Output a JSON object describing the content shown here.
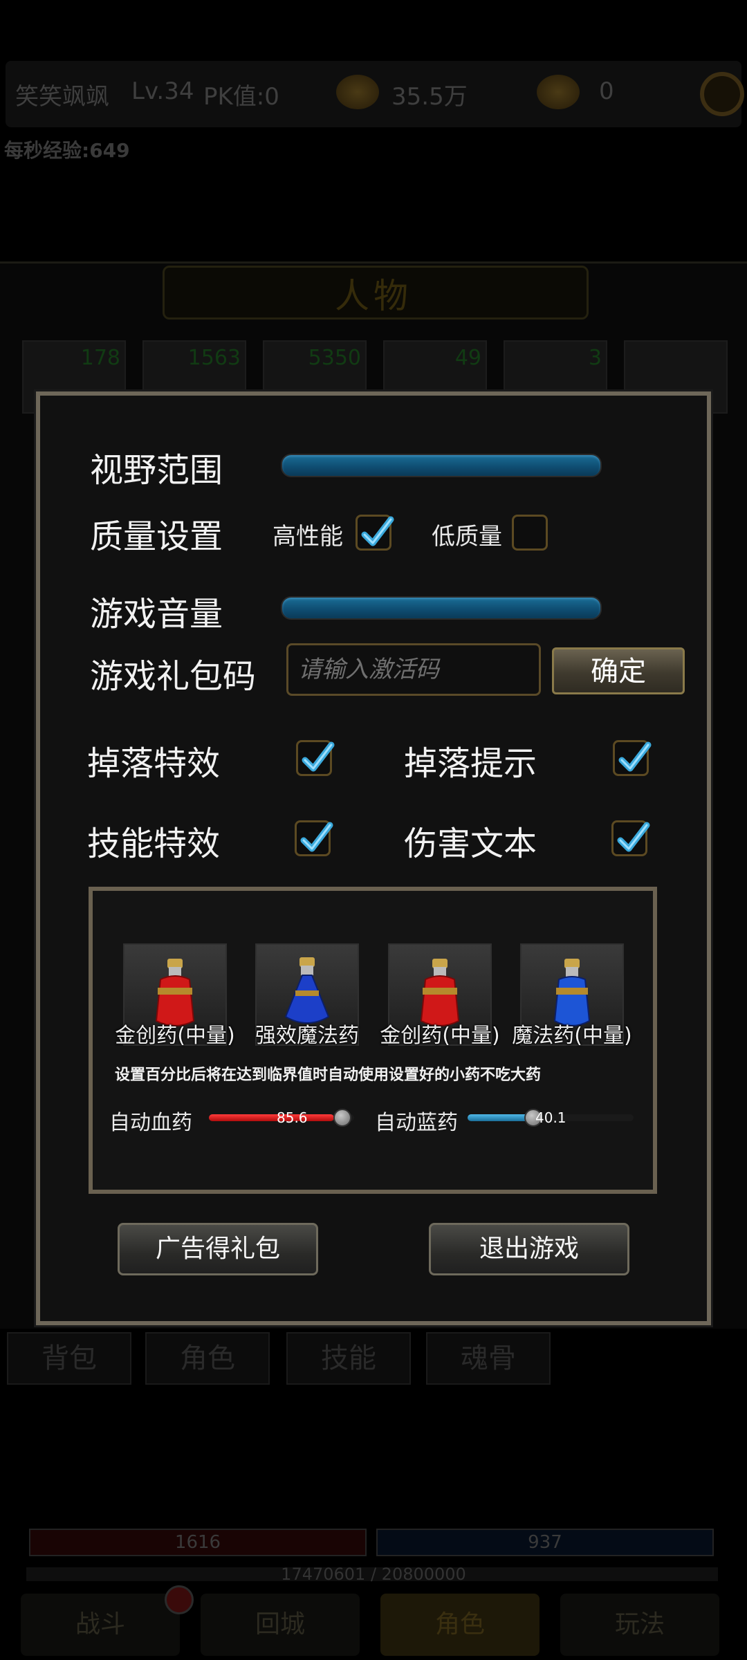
{
  "background": {
    "player_name": "笑笑飒飒",
    "level": "Lv.34",
    "pk": "PK值:0",
    "gold": "35.5万",
    "ingots": "0",
    "exp_per_sec": "每秒经验:649",
    "panel_title": "人物",
    "item_counts": [
      "178",
      "1563",
      "5350",
      "49",
      "3"
    ],
    "tabs": [
      "背包",
      "角色",
      "技能",
      "魂骨"
    ],
    "hp": "1616",
    "mp": "937",
    "exp": "17470601 / 20800000",
    "nav": [
      "战斗",
      "回城",
      "角色",
      "玩法"
    ]
  },
  "settings": {
    "view_range_label": "视野范围",
    "quality_label": "质量设置",
    "high_perf_label": "高性能",
    "high_perf_checked": true,
    "low_quality_label": "低质量",
    "low_quality_checked": false,
    "volume_label": "游戏音量",
    "gift_code_label": "游戏礼包码",
    "gift_code_placeholder": "请输入激活码",
    "confirm_label": "确定",
    "drop_effect_label": "掉落特效",
    "drop_hint_label": "掉落提示",
    "skill_effect_label": "技能特效",
    "damage_text_label": "伤害文本"
  },
  "potions": {
    "items": [
      "金创药(中量)",
      "强效魔法药",
      "金创药(中量)",
      "魔法药(中量)"
    ],
    "hint": "设置百分比后将在达到临界值时自动使用设置好的小药不吃大药",
    "auto_hp_label": "自动血药",
    "auto_hp_value": "85.6",
    "auto_mp_label": "自动蓝药",
    "auto_mp_value": "40.1"
  },
  "buttons": {
    "ad_gift": "广告得礼包",
    "exit_game": "退出游戏"
  },
  "colors": {
    "dialog_bg": "#111111",
    "dialog_border": "#6e6759",
    "check_tick": "#3aa9dc",
    "slider_blue": "#1a6d95",
    "hp_red": "#d21515"
  }
}
